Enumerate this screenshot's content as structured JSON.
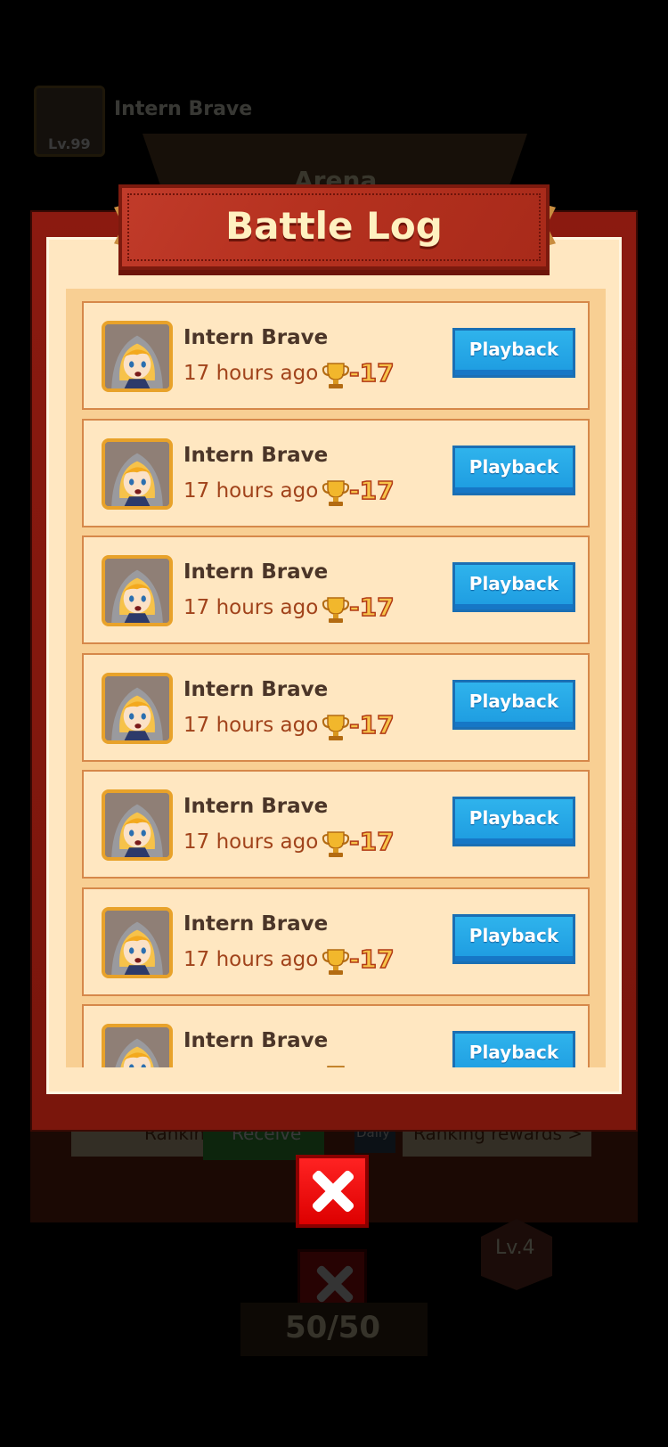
{
  "background": {
    "player_name": "Intern Brave",
    "player_level": "Lv.99",
    "arena_title": "Arena",
    "ranking_label": "Rankin",
    "receive_label": "Receive",
    "daily_label": "Daily",
    "ranking_rewards_label": "Ranking rewards >",
    "level_badge": "Lv.4",
    "stamina": "50/50"
  },
  "dialog": {
    "title": "Battle Log"
  },
  "battle_log": [
    {
      "name": "Intern Brave",
      "time": "17 hours ago",
      "score": "-17",
      "button": "Playback"
    },
    {
      "name": "Intern Brave",
      "time": "17 hours ago",
      "score": "-17",
      "button": "Playback"
    },
    {
      "name": "Intern Brave",
      "time": "17 hours ago",
      "score": "-17",
      "button": "Playback"
    },
    {
      "name": "Intern Brave",
      "time": "17 hours ago",
      "score": "-17",
      "button": "Playback"
    },
    {
      "name": "Intern Brave",
      "time": "17 hours ago",
      "score": "-17",
      "button": "Playback"
    },
    {
      "name": "Intern Brave",
      "time": "17 hours ago",
      "score": "-17",
      "button": "Playback"
    },
    {
      "name": "Intern Brave",
      "time": "",
      "score": "",
      "button": "Playback"
    }
  ],
  "icons": {
    "trophy": "trophy-icon",
    "close": "close-icon"
  },
  "colors": {
    "playback_blue": "#1d9be0",
    "banner_red": "#b5311f",
    "panel_cream": "#ffe7c1",
    "close_red": "#e00000"
  }
}
